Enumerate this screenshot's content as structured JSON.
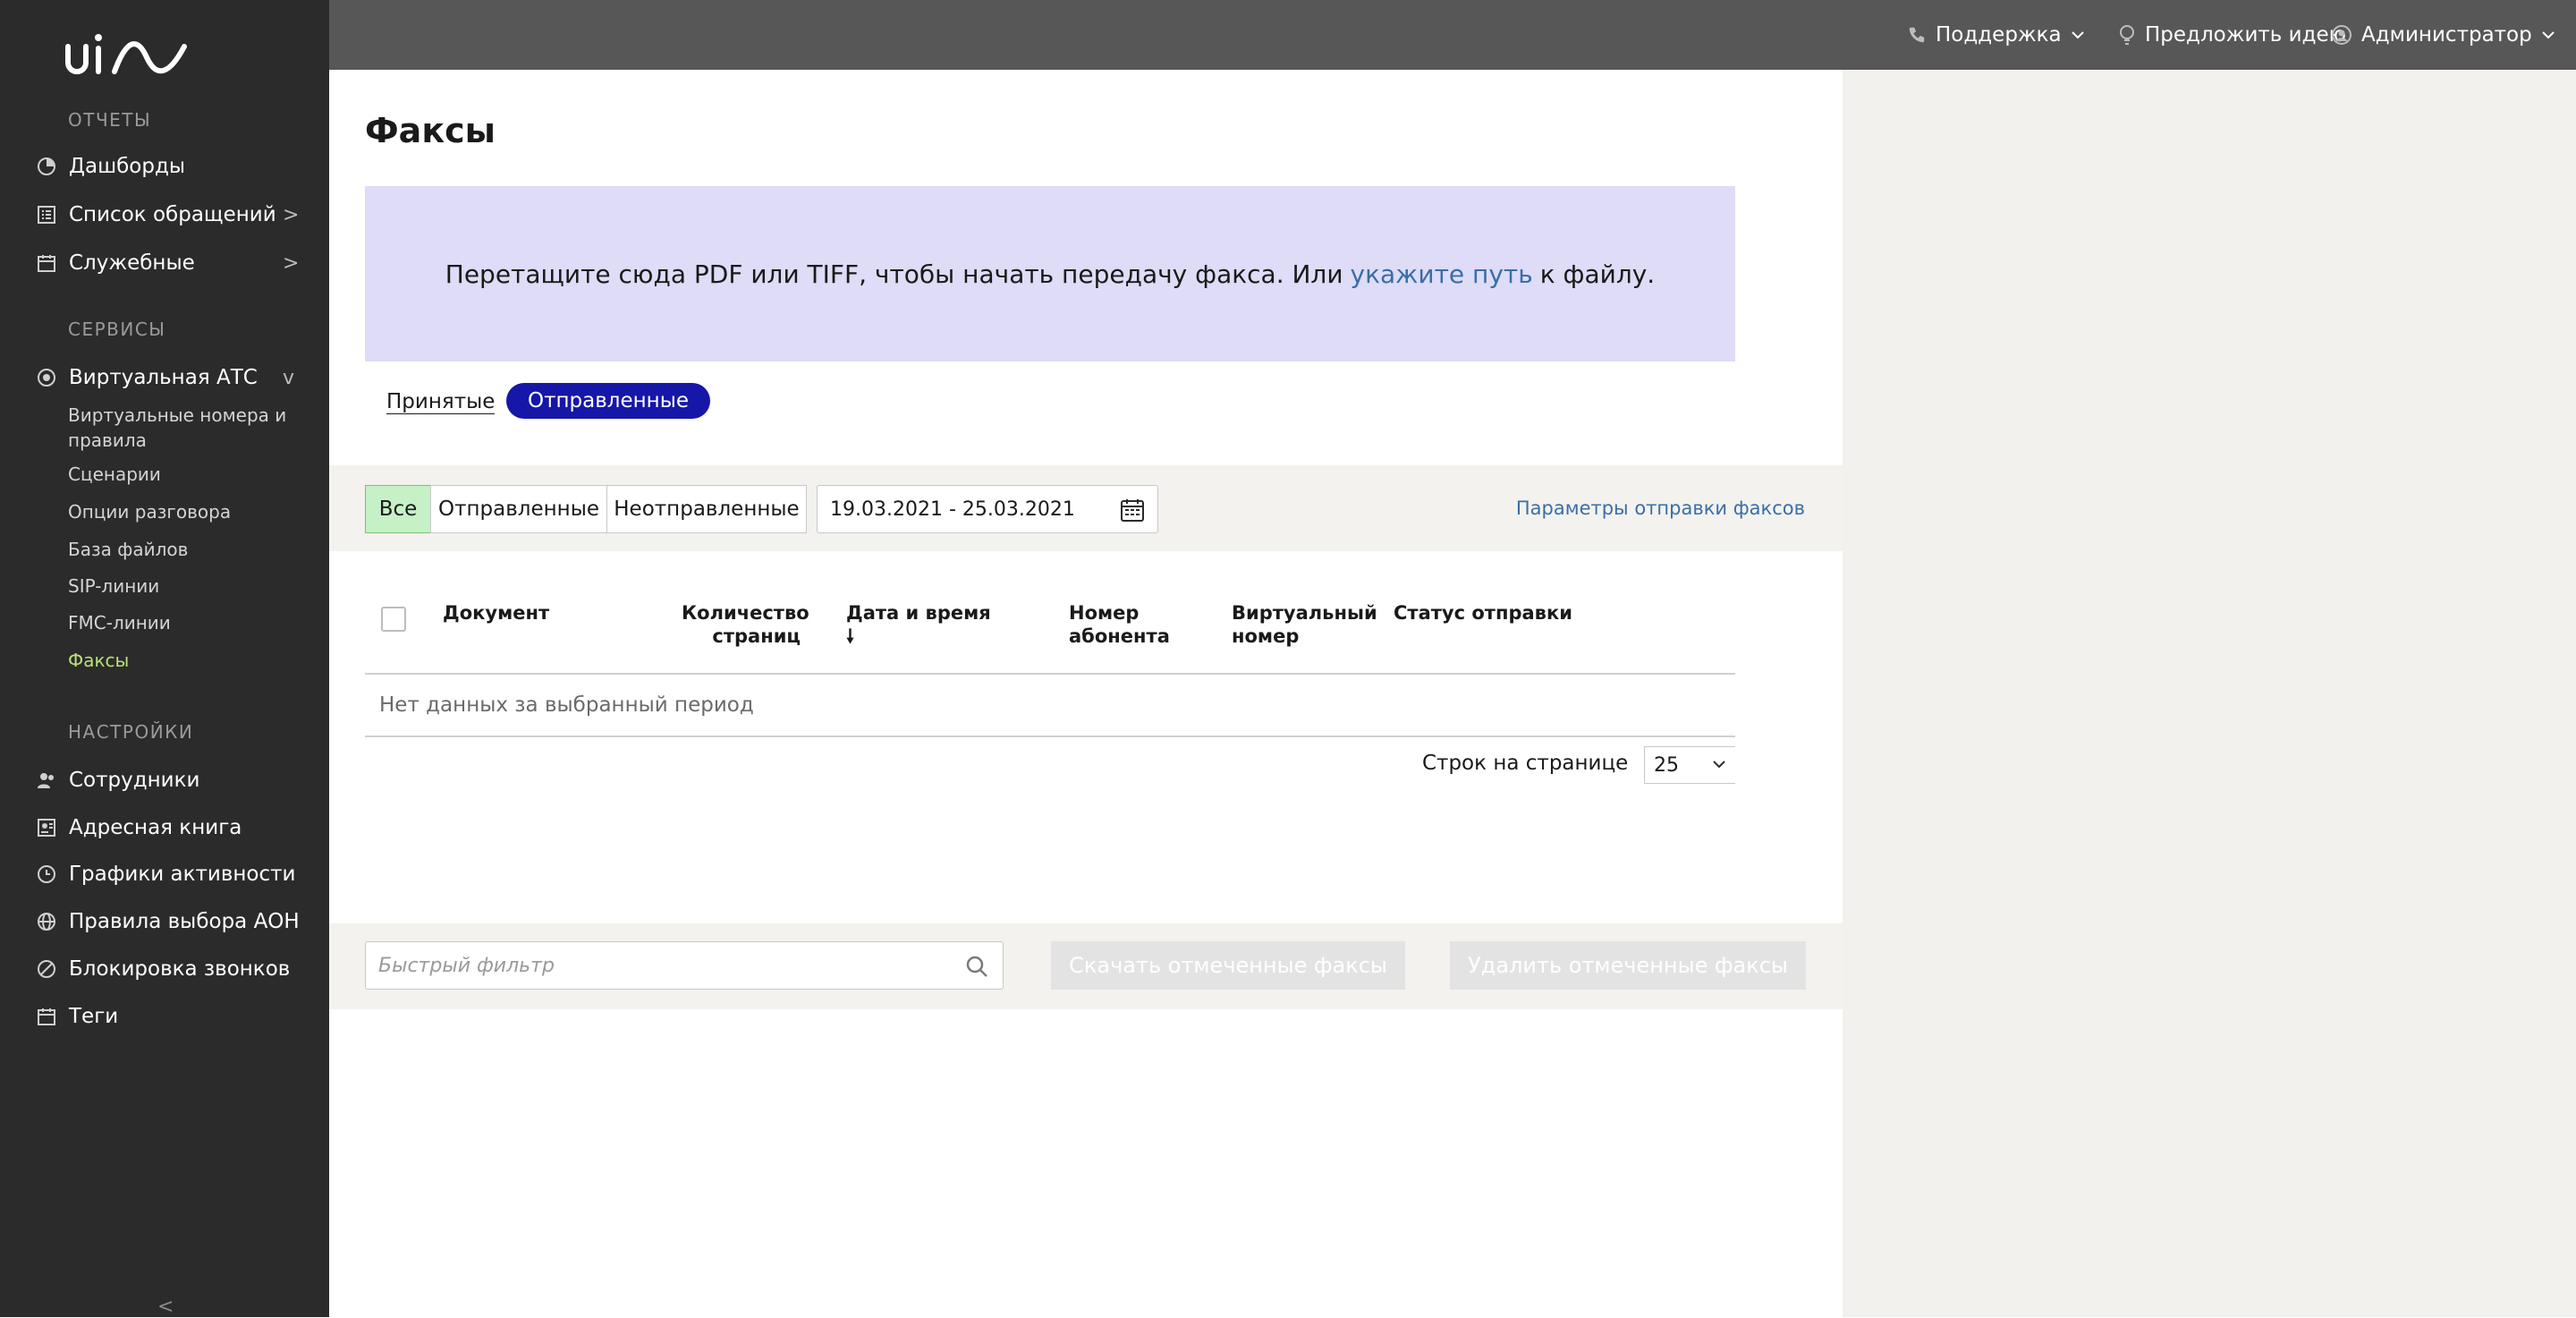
{
  "sidebar": {
    "logo_text": "uis",
    "sections": {
      "reports": "ОТЧЕТЫ",
      "services": "СЕРВИСЫ",
      "settings": "НАСТРОЙКИ"
    },
    "reports_items": [
      {
        "label": "Дашборды",
        "icon": "pie-chart-icon"
      },
      {
        "label": "Список обращений",
        "icon": "list-icon",
        "arrow": ">"
      },
      {
        "label": "Служебные",
        "icon": "calendar-icon",
        "arrow": ">"
      }
    ],
    "vats": {
      "label": "Виртуальная АТС",
      "icon": "phone-globe-icon",
      "arrow": "v"
    },
    "vats_subitems": [
      "Виртуальные номера и правила",
      "Сценарии",
      "Опции разговора",
      "База файлов",
      "SIP-линии",
      "FMC-линии",
      "Факсы"
    ],
    "settings_items": [
      {
        "label": "Сотрудники",
        "icon": "users-icon"
      },
      {
        "label": "Адресная книга",
        "icon": "address-book-icon"
      },
      {
        "label": "Графики активности",
        "icon": "clock-icon"
      },
      {
        "label": "Правила выбора АОН",
        "icon": "globe-icon"
      },
      {
        "label": "Блокировка звонков",
        "icon": "block-icon"
      },
      {
        "label": "Теги",
        "icon": "tag-icon"
      }
    ],
    "collapse": "<"
  },
  "topbar": {
    "support": "Поддержка",
    "suggest": "Предложить идею",
    "admin": "Администратор"
  },
  "main": {
    "title": "Факсы",
    "dropzone": {
      "before": "Перетащите сюда PDF или TIFF, чтобы начать передачу факса. Или",
      "link": "укажите путь",
      "after": "к файлу."
    },
    "tabs": {
      "received": "Принятые",
      "sent": "Отправленные"
    },
    "filters": {
      "all": "Все",
      "sent": "Отправленные",
      "unsent": "Неотправленные",
      "date_range": "19.03.2021 - 25.03.2021",
      "params_link": "Параметры отправки факсов"
    },
    "table": {
      "columns": [
        "Документ",
        "Количество страниц",
        "Дата и время",
        "Номер абонента",
        "Виртуальный номер",
        "Статус отправки"
      ],
      "sort_arrow": "🠗",
      "empty": "Нет данных за выбранный период",
      "rows_per_page_label": "Строк на странице",
      "rows_per_page": "25"
    },
    "bottom": {
      "quick_filter_placeholder": "Быстрый фильтр",
      "download_btn": "Скачать отмеченные факсы",
      "delete_btn": "Удалить отмеченные факсы"
    }
  },
  "colors": {
    "sidebar_bg": "#2b2b2b",
    "topbar_bg": "#575757",
    "dropzone_bg": "#dedcf6",
    "pill_active": "#1616a8",
    "active_subitem": "#b7e07a",
    "link": "#3a6ea8"
  }
}
